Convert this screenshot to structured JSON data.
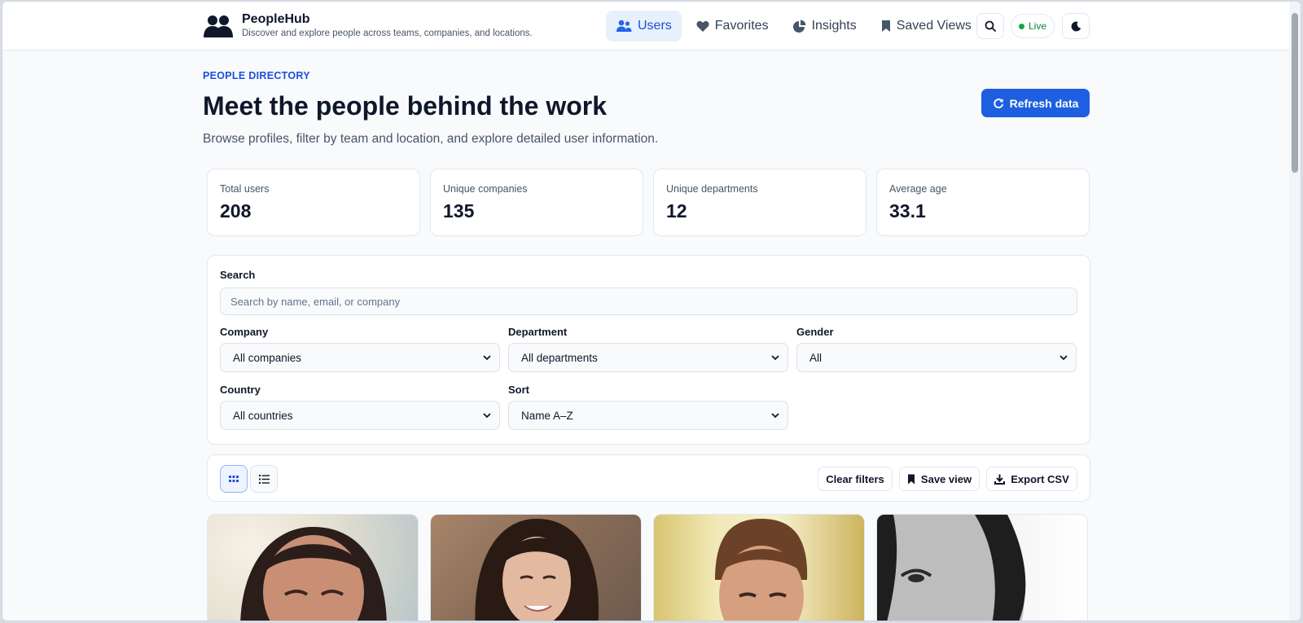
{
  "app": {
    "name": "PeopleHub",
    "tagline": "Discover and explore people across teams, companies, and locations."
  },
  "nav": {
    "items": [
      {
        "label": "Users",
        "icon": "users-icon",
        "active": true
      },
      {
        "label": "Favorites",
        "icon": "heart-icon",
        "active": false
      },
      {
        "label": "Insights",
        "icon": "pie-chart-icon",
        "active": false
      },
      {
        "label": "Saved Views",
        "icon": "bookmark-icon",
        "active": false
      }
    ],
    "live_label": "Live"
  },
  "header": {
    "eyebrow": "PEOPLE DIRECTORY",
    "title": "Meet the people behind the work",
    "subtitle": "Browse profiles, filter by team and location, and explore detailed user information.",
    "refresh_label": "Refresh data"
  },
  "stats": [
    {
      "label": "Total users",
      "value": "208"
    },
    {
      "label": "Unique companies",
      "value": "135"
    },
    {
      "label": "Unique departments",
      "value": "12"
    },
    {
      "label": "Average age",
      "value": "33.1"
    }
  ],
  "filters": {
    "search_label": "Search",
    "search_placeholder": "Search by name, email, or company",
    "search_value": "",
    "company_label": "Company",
    "company_value": "All companies",
    "department_label": "Department",
    "department_value": "All departments",
    "gender_label": "Gender",
    "gender_value": "All",
    "country_label": "Country",
    "country_value": "All countries",
    "sort_label": "Sort",
    "sort_value": "Name A–Z"
  },
  "toolbar": {
    "view_mode": "grid",
    "clear_label": "Clear filters",
    "save_label": "Save view",
    "export_label": "Export CSV"
  },
  "colors": {
    "accent": "#1d5fe0",
    "accent_text": "#1d4ed8",
    "live": "#16a34a"
  }
}
